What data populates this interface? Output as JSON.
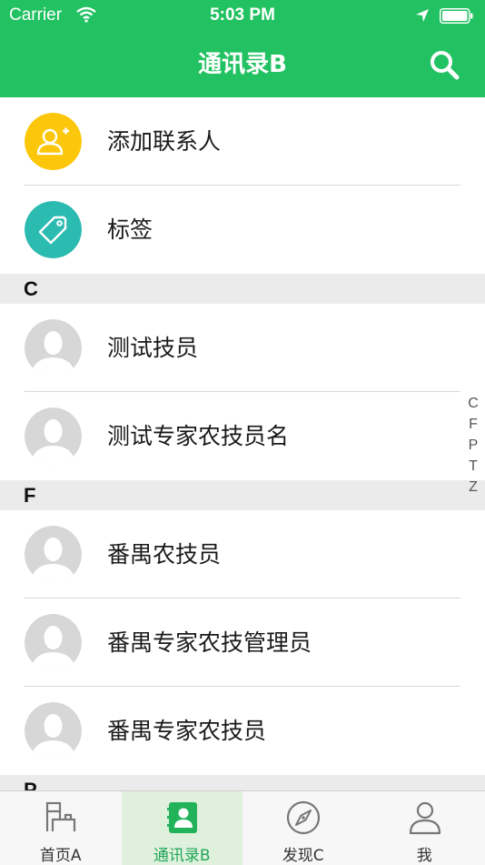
{
  "status": {
    "carrier": "Carrier",
    "time": "5:03 PM"
  },
  "nav": {
    "title": "通讯录B",
    "search_icon": "search-icon"
  },
  "actions": [
    {
      "label": "添加联系人",
      "icon": "add-contact-icon",
      "color": "#fcc70a"
    },
    {
      "label": "标签",
      "icon": "tag-icon",
      "color": "#2cbbb0"
    }
  ],
  "sections": [
    {
      "letter": "C",
      "contacts": [
        "测试技员",
        "测试专家农技员名"
      ]
    },
    {
      "letter": "F",
      "contacts": [
        "番禺农技员",
        "番禺专家农技管理员",
        "番禺专家农技员"
      ]
    },
    {
      "letter": "P",
      "contacts": []
    }
  ],
  "index": [
    "C",
    "F",
    "P",
    "T",
    "Z"
  ],
  "tabs": [
    {
      "label": "首页A",
      "icon": "home-icon",
      "active": false
    },
    {
      "label": "通讯录B",
      "icon": "contacts-icon",
      "active": true
    },
    {
      "label": "发现C",
      "icon": "compass-icon",
      "active": false
    },
    {
      "label": "我",
      "icon": "profile-icon",
      "active": false
    }
  ],
  "colors": {
    "brand": "#22c262",
    "section_bg": "#ebebeb",
    "active_tab_bg": "#dff1dc"
  }
}
